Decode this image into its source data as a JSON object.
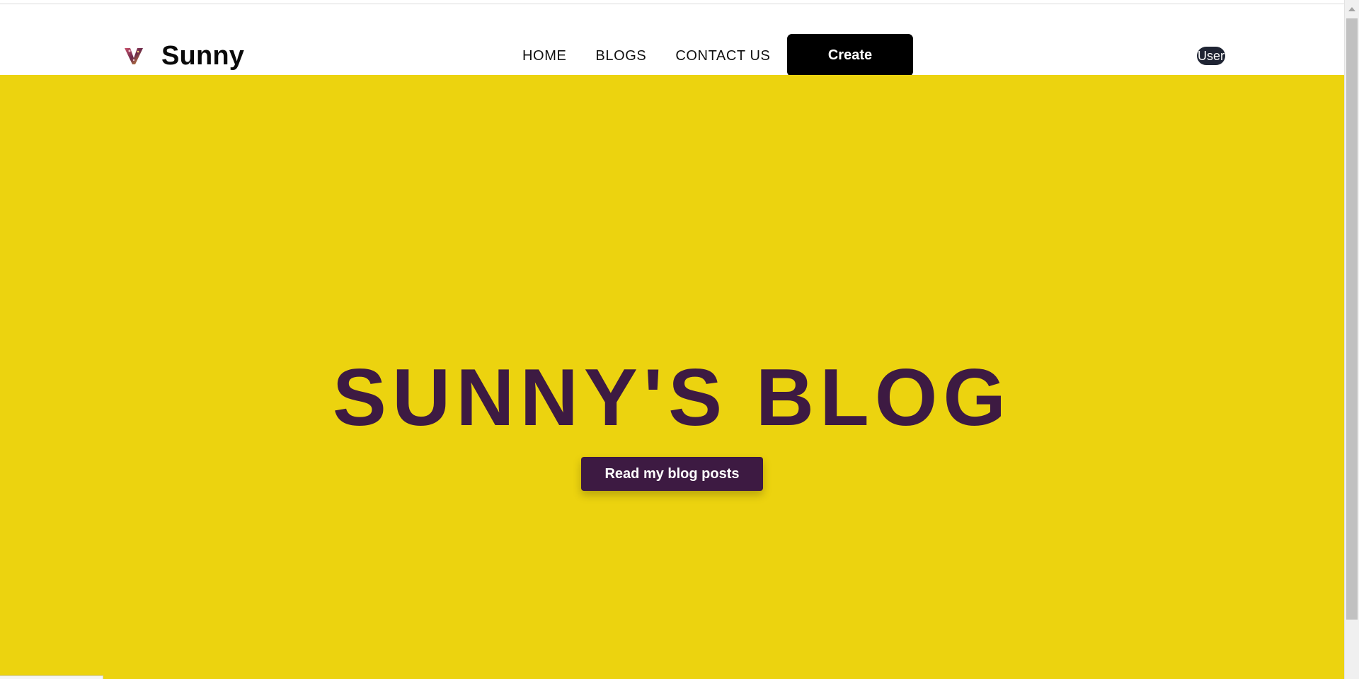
{
  "navbar": {
    "brand_name": "Sunny",
    "links": [
      "HOME",
      "BLOGS",
      "CONTACT US"
    ],
    "create_label": "Create",
    "user_label": "User"
  },
  "hero": {
    "title": "SUNNY'S BLOG",
    "button_label": "Read my blog posts"
  },
  "colors": {
    "hero_background": "#ecd30f",
    "accent_purple": "#3d1a42",
    "create_button": "#000000",
    "user_button": "#1f2433"
  },
  "icons": {
    "logo": "v-logo-icon"
  }
}
